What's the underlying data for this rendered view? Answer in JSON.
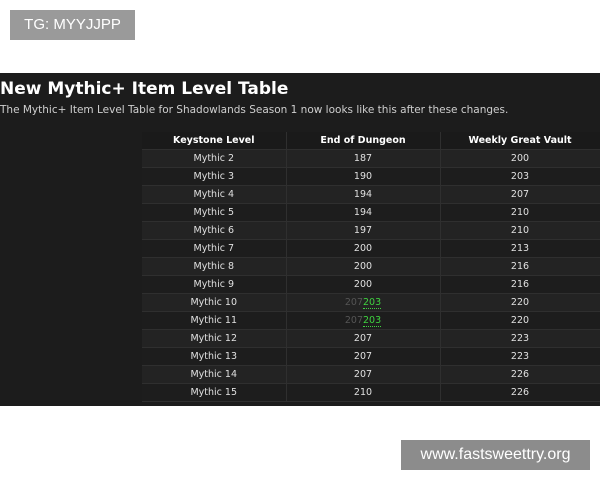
{
  "badge": {
    "text": "TG: MYYJJPP"
  },
  "article": {
    "title": "New Mythic+ Item Level Table",
    "subtitle": "The Mythic+ Item Level Table for Shadowlands Season 1 now looks like this after these changes."
  },
  "table": {
    "headers": [
      "Keystone Level",
      "End of Dungeon",
      "Weekly Great Vault"
    ],
    "rows": [
      {
        "level": "Mythic 2",
        "end": "187",
        "vault": "200"
      },
      {
        "level": "Mythic 3",
        "end": "190",
        "vault": "203"
      },
      {
        "level": "Mythic 4",
        "end": "194",
        "vault": "207"
      },
      {
        "level": "Mythic 5",
        "end": "194",
        "vault": "210"
      },
      {
        "level": "Mythic 6",
        "end": "197",
        "vault": "210"
      },
      {
        "level": "Mythic 7",
        "end": "200",
        "vault": "213"
      },
      {
        "level": "Mythic 8",
        "end": "200",
        "vault": "216"
      },
      {
        "level": "Mythic 9",
        "end": "200",
        "vault": "216"
      },
      {
        "level": "Mythic 10",
        "end_old": "207",
        "end_new": "203",
        "vault": "220"
      },
      {
        "level": "Mythic 11",
        "end_old": "207",
        "end_new": "203",
        "vault": "220"
      },
      {
        "level": "Mythic 12",
        "end": "207",
        "vault": "223"
      },
      {
        "level": "Mythic 13",
        "end": "207",
        "vault": "223"
      },
      {
        "level": "Mythic 14",
        "end": "207",
        "vault": "226"
      },
      {
        "level": "Mythic 15",
        "end": "210",
        "vault": "226"
      }
    ]
  },
  "colors": {
    "panel_bg": "#1c1c1c",
    "changed_value": "#3fd23f",
    "old_value": "#555555"
  },
  "watermark": {
    "text": "www.fastsweettry.org"
  }
}
